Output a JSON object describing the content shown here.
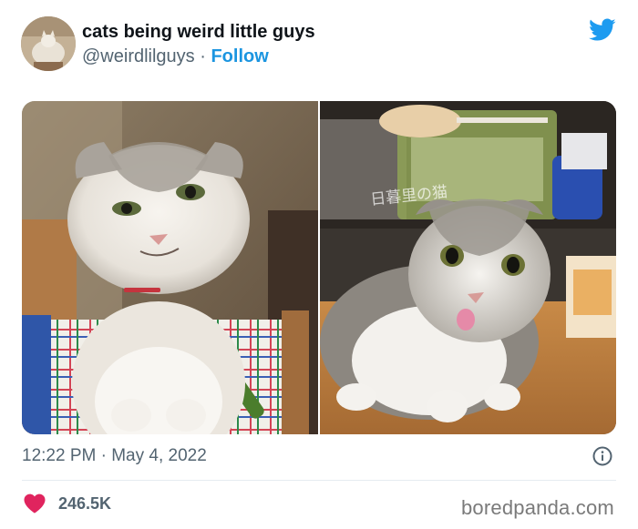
{
  "tweet": {
    "display_name": "cats being weird little guys",
    "handle": "@weirdlilguys",
    "separator": " · ",
    "follow_label": "Follow",
    "timestamp": "12:22 PM · May 4, 2022",
    "likes": "246.5K"
  },
  "media": {
    "left_photo_overlay_text": "",
    "right_photo_overlay_text": "日暮里の猫"
  },
  "watermark": "boredpanda.com",
  "colors": {
    "brand_blue": "#1b95e0",
    "heart_red": "#e0245e",
    "secondary_text": "#536471",
    "primary_text": "#0f1419"
  },
  "icons": {
    "brand": "twitter-bird-icon",
    "info": "info-icon",
    "like": "heart-icon"
  }
}
